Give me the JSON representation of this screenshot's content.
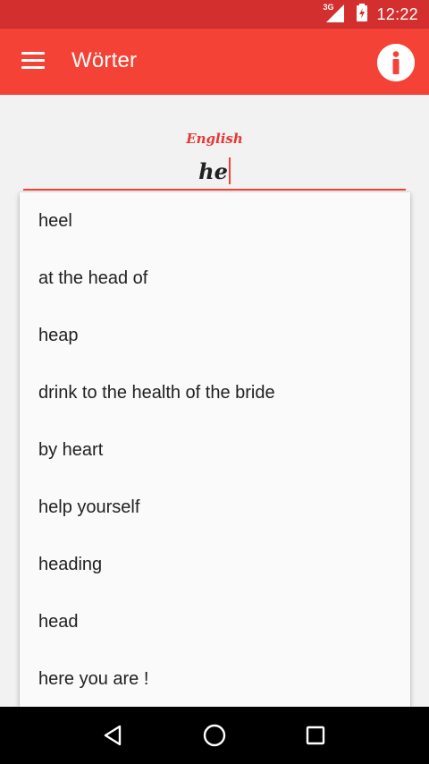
{
  "status_bar": {
    "network_label": "3G",
    "time": "12:22"
  },
  "app_bar": {
    "title": "Wörter",
    "menu_icon": "hamburger-menu-icon",
    "info_icon": "info-icon"
  },
  "search": {
    "label": "English",
    "value": "he"
  },
  "suggestions": [
    "heel",
    "at the head of",
    "heap",
    "drink to the health of the bride",
    "by heart",
    "help yourself",
    "heading",
    "head",
    "here you are !"
  ],
  "nav_bar": {
    "back_icon": "back-triangle-icon",
    "home_icon": "home-circle-icon",
    "recents_icon": "recents-square-icon"
  },
  "colors": {
    "primary": "#f44336",
    "primary_dark": "#d32f2f"
  }
}
